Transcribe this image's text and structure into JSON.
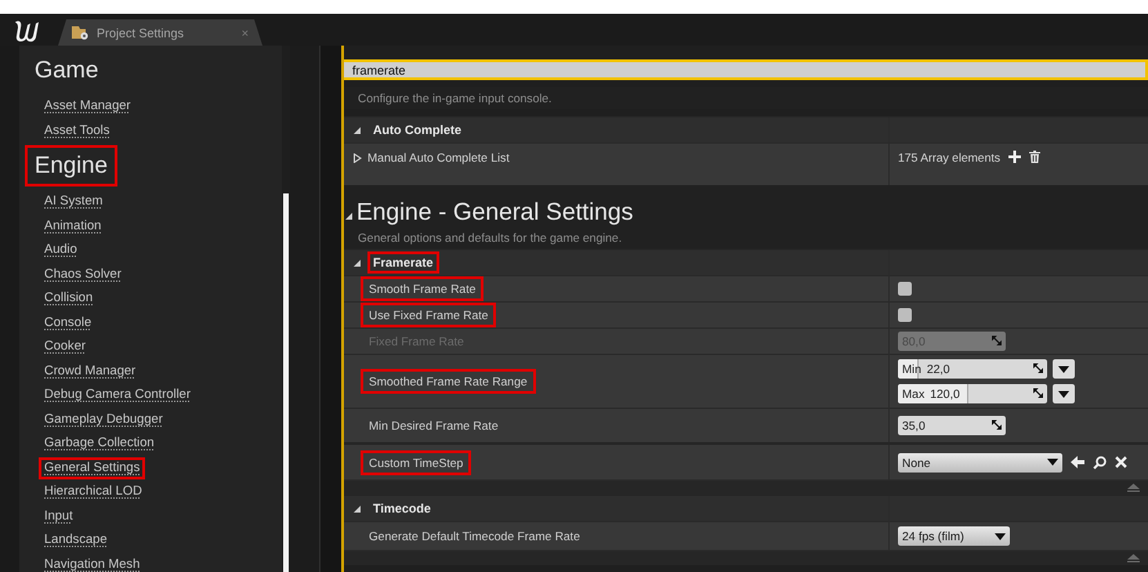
{
  "tab": {
    "title": "Project Settings",
    "close": "×"
  },
  "search": {
    "value": "framerate"
  },
  "sidebar": {
    "items": [
      {
        "kind": "heading",
        "label": "Game",
        "highlighted": false
      },
      {
        "kind": "link",
        "label": "Asset Manager",
        "highlighted": false
      },
      {
        "kind": "link",
        "label": "Asset Tools",
        "highlighted": false
      },
      {
        "kind": "heading",
        "label": "Engine",
        "highlighted": true
      },
      {
        "kind": "link",
        "label": "AI System",
        "highlighted": false
      },
      {
        "kind": "link",
        "label": "Animation",
        "highlighted": false
      },
      {
        "kind": "link",
        "label": "Audio",
        "highlighted": false
      },
      {
        "kind": "link",
        "label": "Chaos Solver",
        "highlighted": false
      },
      {
        "kind": "link",
        "label": "Collision",
        "highlighted": false
      },
      {
        "kind": "link",
        "label": "Console",
        "highlighted": false
      },
      {
        "kind": "link",
        "label": "Cooker",
        "highlighted": false
      },
      {
        "kind": "link",
        "label": "Crowd Manager",
        "highlighted": false
      },
      {
        "kind": "link",
        "label": "Debug Camera Controller",
        "highlighted": false
      },
      {
        "kind": "link",
        "label": "Gameplay Debugger",
        "highlighted": false
      },
      {
        "kind": "link",
        "label": "Garbage Collection",
        "highlighted": false
      },
      {
        "kind": "link",
        "label": "General Settings",
        "highlighted": true
      },
      {
        "kind": "link",
        "label": "Hierarchical LOD",
        "highlighted": false
      },
      {
        "kind": "link",
        "label": "Input",
        "highlighted": false
      },
      {
        "kind": "link",
        "label": "Landscape",
        "highlighted": false
      },
      {
        "kind": "link",
        "label": "Navigation Mesh",
        "highlighted": false
      }
    ]
  },
  "details": {
    "rows": [
      {
        "kind": "description",
        "text": "Configure the in-game input console."
      },
      {
        "kind": "category",
        "label": "Auto Complete",
        "expanded": true,
        "highlighted": false
      },
      {
        "kind": "array",
        "label": "Manual Auto Complete List",
        "expanded": false,
        "value": "175 Array elements"
      },
      {
        "kind": "title",
        "label": "Engine - General Settings",
        "expanded": true
      },
      {
        "kind": "description",
        "text": "General options and defaults for the game engine."
      },
      {
        "kind": "category",
        "label": "Framerate",
        "expanded": true,
        "highlighted": true
      },
      {
        "kind": "checkbox",
        "label": "Smooth Frame Rate",
        "highlighted": true,
        "disabled": false,
        "checked": false
      },
      {
        "kind": "checkbox",
        "label": "Use Fixed Frame Rate",
        "highlighted": true,
        "disabled": false,
        "checked": false
      },
      {
        "kind": "number",
        "label": "Fixed Frame Rate",
        "highlighted": false,
        "disabled": true,
        "value": "80,0"
      },
      {
        "kind": "range",
        "label": "Smoothed Frame Rate Range",
        "highlighted": true,
        "disabled": false,
        "bounds": [
          {
            "label": "Min",
            "value": "22,0",
            "level": 0.13
          },
          {
            "label": "Max",
            "value": "120,0",
            "level": 0.46
          }
        ]
      },
      {
        "kind": "number",
        "label": "Min Desired Frame Rate",
        "highlighted": false,
        "disabled": false,
        "value": "35,0"
      },
      {
        "kind": "combo",
        "label": "Custom TimeStep",
        "highlighted": true,
        "disabled": false,
        "value": "None"
      },
      {
        "kind": "collapse"
      },
      {
        "kind": "category",
        "label": "Timecode",
        "expanded": true,
        "highlighted": false
      },
      {
        "kind": "dropdown",
        "label": "Generate Default Timecode Frame Rate",
        "highlighted": false,
        "disabled": false,
        "value": "24 fps (film)"
      },
      {
        "kind": "collapse"
      }
    ]
  }
}
